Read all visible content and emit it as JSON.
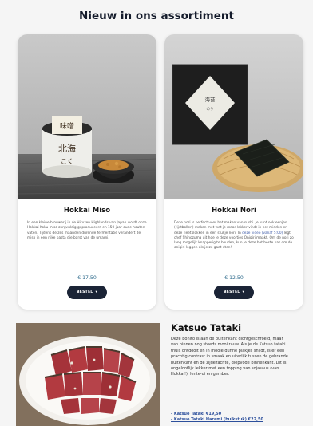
{
  "section_title": "Nieuw in ons assortiment",
  "products": [
    {
      "name": "Hokkai Miso",
      "description": "In een kleine brouwerij in de Hiruzen Highlands van Japan wordt onze Hokkai Koku miso zorgvuldig geproduceerd en 150 jaar oude houten vaten. Tijdens de zes maanden durende fermentatie verandert de miso in een rijke pasta die barst van de umami.",
      "price": "€ 17,50",
      "button_label": "BESTEL"
    },
    {
      "name": "Hokkai Nori",
      "description_before": "Deze nori is perfect voor het maken van sushi. Je kunt ook eenjes (rijstbollen) maken met wat je maar lekker vindt in het midden en deze rieetblokken in een stukje nori. In ",
      "description_link": "deze video (vanaf 5:00)",
      "description_after": " legt chef Shinozuma uit hoe je deze voortjes Onigiri maakt. Om de nori zo lang mogelijk knapperig te houden, kun je deze het beste pas om de onigiri leggen als je ze gaat eten!",
      "price": "€ 12,50",
      "button_label": "BESTEL"
    }
  ],
  "feature": {
    "title": "Katsuo Tataki",
    "text": "Deze bonito is aan de buitenkant dichtgeschroeid, maar van binnen nog steeds mooi rauw. Als je de Katsuo tataki thuis ontdooit en in mooie dunne plakjes snijdt, is er een prachtig contrast in smaak en uiterlijk tussen de gebrande buitenkant en de zijdezachte, diepvode binnenkant. Dit is ongelooflijk lekker met een topping van sojasaus (van Hokkai!), lente-ui en gember.",
    "links": [
      "- Katsuo Tataki €19,50",
      "- Katsuo Tataki Harami (buikstuk) €22,50"
    ]
  },
  "colors": {
    "button_bg": "#1b2436",
    "price": "#2f6b8c",
    "link": "#2c4f9c",
    "title": "#151c2c"
  }
}
